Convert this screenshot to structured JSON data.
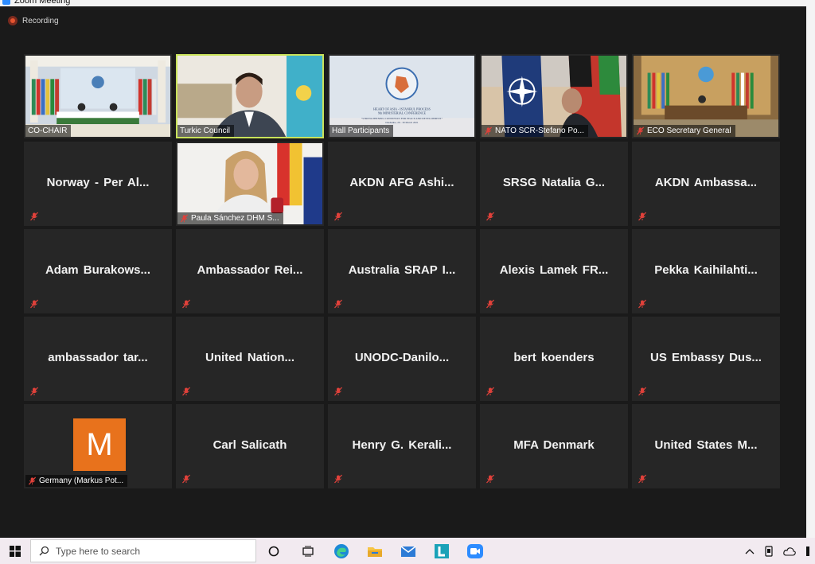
{
  "window": {
    "title": "Zoom Meeting"
  },
  "recording": {
    "label": "Recording"
  },
  "participants": [
    {
      "name": "CO-CHAIR"
    },
    {
      "name": "Turkic Council"
    },
    {
      "name": "Hall Participants"
    },
    {
      "name": "NATO SCR-Stefano Po..."
    },
    {
      "name": "ECO Secretary General"
    },
    {
      "name": "Norway - Per Al..."
    },
    {
      "name": "Paula Sánchez DHM S..."
    },
    {
      "name": "AKDN AFG Ashi..."
    },
    {
      "name": "SRSG Natalia G..."
    },
    {
      "name": "AKDN Ambassa..."
    },
    {
      "name": "Adam Burakows..."
    },
    {
      "name": "Ambassador Rei..."
    },
    {
      "name": "Australia SRAP I..."
    },
    {
      "name": "Alexis Lamek FR..."
    },
    {
      "name": "Pekka Kaihilahti..."
    },
    {
      "name": "ambassador tar..."
    },
    {
      "name": "United Nation..."
    },
    {
      "name": "UNODC-Danilo..."
    },
    {
      "name": "bert koenders"
    },
    {
      "name": "US Embassy Dus..."
    },
    {
      "name": "Germany (Markus Pot...",
      "avatar_letter": "M"
    },
    {
      "name": "Carl Salicath"
    },
    {
      "name": "Henry G. Kerali..."
    },
    {
      "name": "MFA Denmark"
    },
    {
      "name": "United States M..."
    }
  ],
  "banner": {
    "line1": "HEART OF ASIA - ISTANBUL PROCESS",
    "line2": "9th MINISTERIAL CONFERENCE",
    "line3": "\"STRENGTHENING CONSENSUS FOR PEACE AND DEVELOPMENT\"",
    "line4": "Dushanbe, 29 - 30 March 2021"
  },
  "taskbar": {
    "search_placeholder": "Type here to search"
  },
  "colors": {
    "active_speaker": "#c9e25a",
    "avatar": "#e8721c",
    "mute": "#e0413a"
  }
}
